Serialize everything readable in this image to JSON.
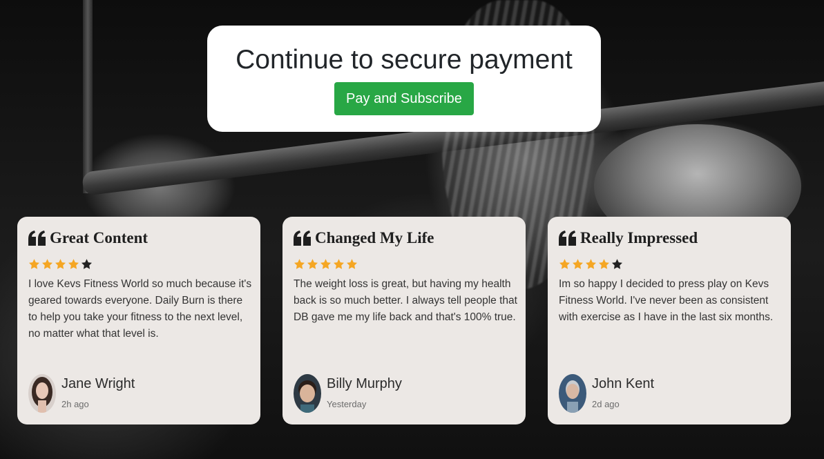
{
  "payment": {
    "title": "Continue to secure payment",
    "button_label": "Pay and Subscribe",
    "button_color": "#28a745"
  },
  "reviews": [
    {
      "title": "Great Content",
      "rating": 4,
      "max_rating": 5,
      "text": "I love Kevs Fitness World so much because it's geared towards everyone. Daily Burn is there to help you take your fitness to the next level, no matter what that level is.",
      "name": "Jane Wright",
      "time": "2h ago"
    },
    {
      "title": "Changed My Life",
      "rating": 5,
      "max_rating": 5,
      "text": "The weight loss is great, but having my health back is so much better. I always tell people that DB gave me my life back and that's 100% true.",
      "name": "Billy Murphy",
      "time": "Yesterday"
    },
    {
      "title": "Really Impressed",
      "rating": 4,
      "max_rating": 5,
      "text": "Im so happy I decided to press play on Kevs Fitness World. I've never been as consistent with exercise as I have in the last six months.",
      "name": "John Kent",
      "time": "2d ago"
    }
  ],
  "colors": {
    "star_filled": "#f5a623",
    "star_empty": "#222222",
    "card_bg": "#ece8e5"
  },
  "icons": {
    "quote": "quote-left-icon",
    "star": "star-icon"
  }
}
